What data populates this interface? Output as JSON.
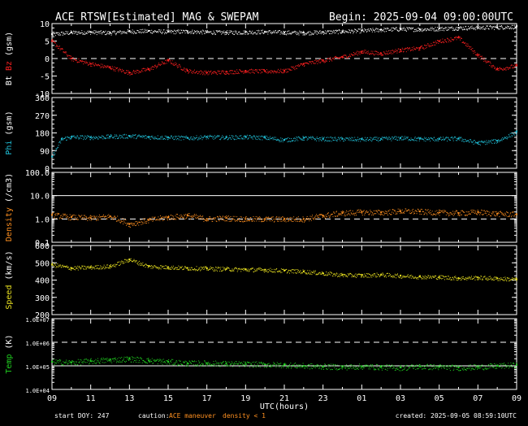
{
  "header": {
    "title": "ACE RTSW[Estimated] MAG & SWEPAM",
    "begin": "Begin: 2025-09-04 09:00:00UTC"
  },
  "footer": {
    "start_doy": "start DOY: 247",
    "caution_label": "caution:",
    "maneuver_label": "ACE maneuver",
    "density_note": "density < 1",
    "created": "created: 2025-09-05 08:59:10UTC"
  },
  "colors": {
    "bt": "#ffffff",
    "bz": "#ff2020",
    "phi": "#20c0d8",
    "density": "#ff9020",
    "speed": "#e8e020",
    "temp": "#20d020",
    "axis": "#ffffff"
  },
  "chart_data": {
    "type": "line",
    "x_axis": {
      "label": "UTC(hours)",
      "ticks": [
        "09",
        "11",
        "13",
        "15",
        "17",
        "19",
        "21",
        "23",
        "01",
        "03",
        "05",
        "07",
        "09"
      ],
      "range_hours": [
        0,
        24
      ]
    },
    "panels": [
      {
        "id": "mag",
        "ylabel_parts": [
          {
            "text": "Bt",
            "color": "#ffffff"
          },
          {
            "text": "Bz",
            "color": "#ff2020"
          },
          {
            "text": "(gsm)",
            "color": "#ffffff"
          }
        ],
        "scale": "linear",
        "ylim": [
          -10,
          10
        ],
        "yticks": [
          "10",
          "5",
          "0",
          "-5",
          "-10"
        ],
        "ref_lines": [
          {
            "value": 0,
            "style": "dashed"
          }
        ],
        "series": [
          {
            "name": "Bt",
            "color": "#ffffff",
            "x": [
              0,
              1,
              2,
              3,
              4,
              5,
              6,
              7,
              8,
              9,
              10,
              11,
              12,
              13,
              14,
              15,
              16,
              17,
              18,
              19,
              20,
              21,
              22,
              23,
              24
            ],
            "values": [
              7.0,
              7.5,
              7.6,
              7.4,
              7.8,
              7.9,
              7.7,
              7.8,
              7.6,
              7.5,
              7.6,
              7.7,
              7.5,
              7.4,
              7.6,
              7.8,
              8.0,
              8.3,
              8.5,
              8.4,
              8.6,
              8.8,
              8.9,
              9.0,
              9.2
            ]
          },
          {
            "name": "Bz",
            "color": "#ff2020",
            "x": [
              0,
              1,
              2,
              3,
              4,
              5,
              6,
              7,
              8,
              9,
              10,
              11,
              12,
              13,
              14,
              15,
              16,
              17,
              18,
              19,
              20,
              21,
              22,
              23,
              24
            ],
            "values": [
              5.0,
              0.0,
              -1.5,
              -2.5,
              -4.0,
              -3.0,
              -0.5,
              -3.5,
              -4.0,
              -3.8,
              -3.5,
              -3.6,
              -3.5,
              -1.5,
              -0.5,
              0.5,
              2.0,
              1.5,
              2.5,
              3.0,
              5.0,
              6.0,
              1.0,
              -3.0,
              -2.0
            ]
          }
        ]
      },
      {
        "id": "phi",
        "ylabel_parts": [
          {
            "text": "Phi",
            "color": "#20c0d8"
          },
          {
            "text": "(gsm)",
            "color": "#ffffff"
          }
        ],
        "scale": "linear",
        "ylim": [
          0,
          360
        ],
        "yticks": [
          "360",
          "270",
          "180",
          "90",
          "0"
        ],
        "ref_lines": [],
        "series": [
          {
            "name": "Phi",
            "color": "#20c0d8",
            "x": [
              0,
              0.5,
              1,
              2,
              3,
              4,
              5,
              6,
              7,
              8,
              9,
              10,
              11,
              12,
              13,
              14,
              15,
              16,
              17,
              18,
              19,
              20,
              21,
              22,
              23,
              24
            ],
            "values": [
              60,
              150,
              160,
              158,
              162,
              165,
              160,
              158,
              155,
              160,
              158,
              160,
              157,
              145,
              155,
              150,
              150,
              148,
              150,
              155,
              150,
              150,
              152,
              130,
              140,
              185
            ]
          }
        ]
      },
      {
        "id": "density",
        "ylabel_parts": [
          {
            "text": "Density",
            "color": "#ff9020"
          },
          {
            "text": "(/cm3)",
            "color": "#ffffff"
          }
        ],
        "scale": "log",
        "ylim": [
          0.1,
          100
        ],
        "yticks": [
          "100.0",
          "10.0",
          "1.0",
          "0.1"
        ],
        "ref_lines": [
          {
            "value": 10,
            "style": "solid"
          },
          {
            "value": 1,
            "style": "dashed"
          }
        ],
        "series": [
          {
            "name": "Density",
            "color": "#ff9020",
            "x": [
              0,
              1,
              2,
              3,
              4,
              5,
              6,
              7,
              8,
              9,
              10,
              11,
              12,
              13,
              14,
              15,
              16,
              17,
              18,
              19,
              20,
              21,
              22,
              23,
              24
            ],
            "values": [
              1.5,
              1.2,
              1.1,
              1.3,
              0.6,
              0.9,
              1.2,
              1.4,
              1.0,
              1.1,
              1.0,
              1.0,
              1.0,
              1.0,
              1.4,
              1.8,
              2.0,
              1.9,
              2.2,
              2.1,
              1.9,
              1.8,
              2.0,
              1.7,
              1.6
            ]
          }
        ]
      },
      {
        "id": "speed",
        "ylabel_parts": [
          {
            "text": "Speed",
            "color": "#e8e020"
          },
          {
            "text": "(km/s)",
            "color": "#ffffff"
          }
        ],
        "scale": "linear",
        "ylim": [
          200,
          600
        ],
        "yticks": [
          "600",
          "500",
          "400",
          "300",
          "200"
        ],
        "ref_lines": [],
        "series": [
          {
            "name": "Speed",
            "color": "#e8e020",
            "x": [
              0,
              1,
              2,
              3,
              4,
              5,
              6,
              7,
              8,
              9,
              10,
              11,
              12,
              13,
              14,
              15,
              16,
              17,
              18,
              19,
              20,
              21,
              22,
              23,
              24
            ],
            "values": [
              490,
              470,
              475,
              480,
              520,
              480,
              475,
              470,
              468,
              465,
              462,
              460,
              455,
              450,
              440,
              430,
              428,
              432,
              425,
              420,
              418,
              412,
              415,
              410,
              405
            ]
          }
        ]
      },
      {
        "id": "temp",
        "ylabel_parts": [
          {
            "text": "Temp",
            "color": "#20d020"
          },
          {
            "text": "(K)",
            "color": "#ffffff"
          }
        ],
        "scale": "log",
        "ylim": [
          10000,
          10000000
        ],
        "yticks": [
          "1.0E+07",
          "1.0E+06",
          "1.0E+05",
          "1.0E+04"
        ],
        "ref_lines": [
          {
            "value": 1000000,
            "style": "dashed"
          },
          {
            "value": 100000,
            "style": "solid"
          }
        ],
        "series": [
          {
            "name": "Temp",
            "color": "#20d020",
            "x": [
              0,
              1,
              2,
              3,
              4,
              5,
              6,
              7,
              8,
              9,
              10,
              11,
              12,
              13,
              14,
              15,
              16,
              17,
              18,
              19,
              20,
              21,
              22,
              23,
              24
            ],
            "values": [
              150000,
              140000,
              160000,
              180000,
              200000,
              170000,
              150000,
              130000,
              130000,
              125000,
              120000,
              115000,
              110000,
              100000,
              95000,
              90000,
              95000,
              90000,
              85000,
              95000,
              90000,
              85000,
              90000,
              100000,
              110000
            ]
          }
        ]
      }
    ]
  }
}
